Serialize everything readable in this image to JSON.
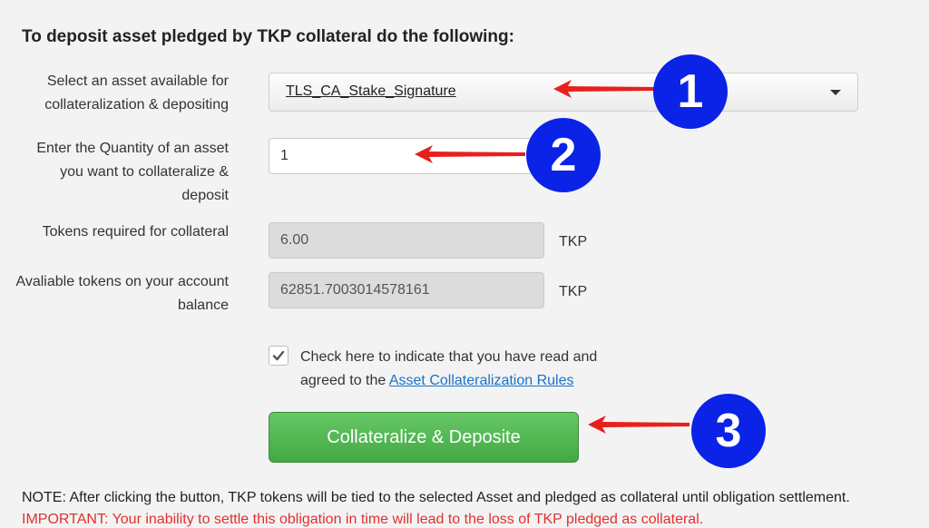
{
  "heading": "To deposit asset pledged by TKP collateral do the following:",
  "asset_select": {
    "label": "Select an asset available for collateralization & depositing",
    "value": "TLS_CA_Stake_Signature"
  },
  "quantity": {
    "label": "Enter the Quantity of an asset you want to collateralize & deposit",
    "value": "1"
  },
  "tokens_required": {
    "label": "Tokens required for collateral",
    "value": "6.00",
    "unit": "TKP"
  },
  "available_tokens": {
    "label": "Avaliable tokens on your account balance",
    "value": "62851.7003014578161",
    "unit": "TKP"
  },
  "agreement": {
    "checked": true,
    "text": "Check here to indicate that you have read and agreed to the ",
    "link": "Asset Collateralization Rules"
  },
  "submit_label": "Collateralize & Deposite",
  "note": "NOTE: After clicking the button, TKP tokens will be tied to the selected Asset and pledged as collateral until obligation settlement.",
  "important": "IMPORTANT: Your inability to settle this obligation in time will lead to the loss of TKP pledged as collateral.",
  "annotations": {
    "badges": [
      "1",
      "2",
      "3"
    ],
    "badge_color": "#0a23e6",
    "arrow_color": "#e8201c"
  }
}
